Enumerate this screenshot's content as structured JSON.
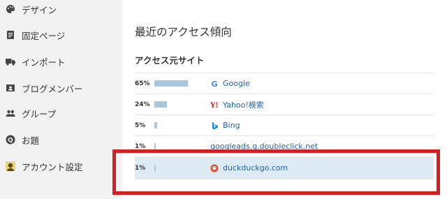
{
  "sidebar": {
    "items": [
      {
        "label": "デザイン",
        "icon": "palette-icon"
      },
      {
        "label": "固定ページ",
        "icon": "page-icon"
      },
      {
        "label": "インポート",
        "icon": "truck-icon"
      },
      {
        "label": "ブログメンバー",
        "icon": "member-card-icon"
      },
      {
        "label": "グループ",
        "icon": "group-icon"
      },
      {
        "label": "お題",
        "icon": "question-icon"
      },
      {
        "label": "アカウント設定",
        "icon": "account-avatar-icon"
      }
    ]
  },
  "main": {
    "title": "最近のアクセス傾向",
    "section_title": "アクセス元サイト",
    "rows": [
      {
        "percent": "65%",
        "share": 0.65,
        "site": "Google",
        "favicon": "google-icon"
      },
      {
        "percent": "24%",
        "share": 0.24,
        "site": "Yahoo!検索",
        "favicon": "yahoo-icon"
      },
      {
        "percent": "5%",
        "share": 0.05,
        "site": "Bing",
        "favicon": "bing-icon"
      },
      {
        "percent": "1%",
        "share": 0.01,
        "site": "googleads.g.doubleclick.net",
        "favicon": ""
      },
      {
        "percent": "1%",
        "share": 0.01,
        "site": "duckduckgo.com",
        "favicon": "duckduckgo-icon",
        "highlighted": true
      }
    ]
  },
  "colors": {
    "bar": "#a9c6e0",
    "link": "#1f63a8",
    "highlight": "#dcebf4",
    "annotation": "#d12026",
    "sidebar_bg": "#f2f2f2"
  }
}
